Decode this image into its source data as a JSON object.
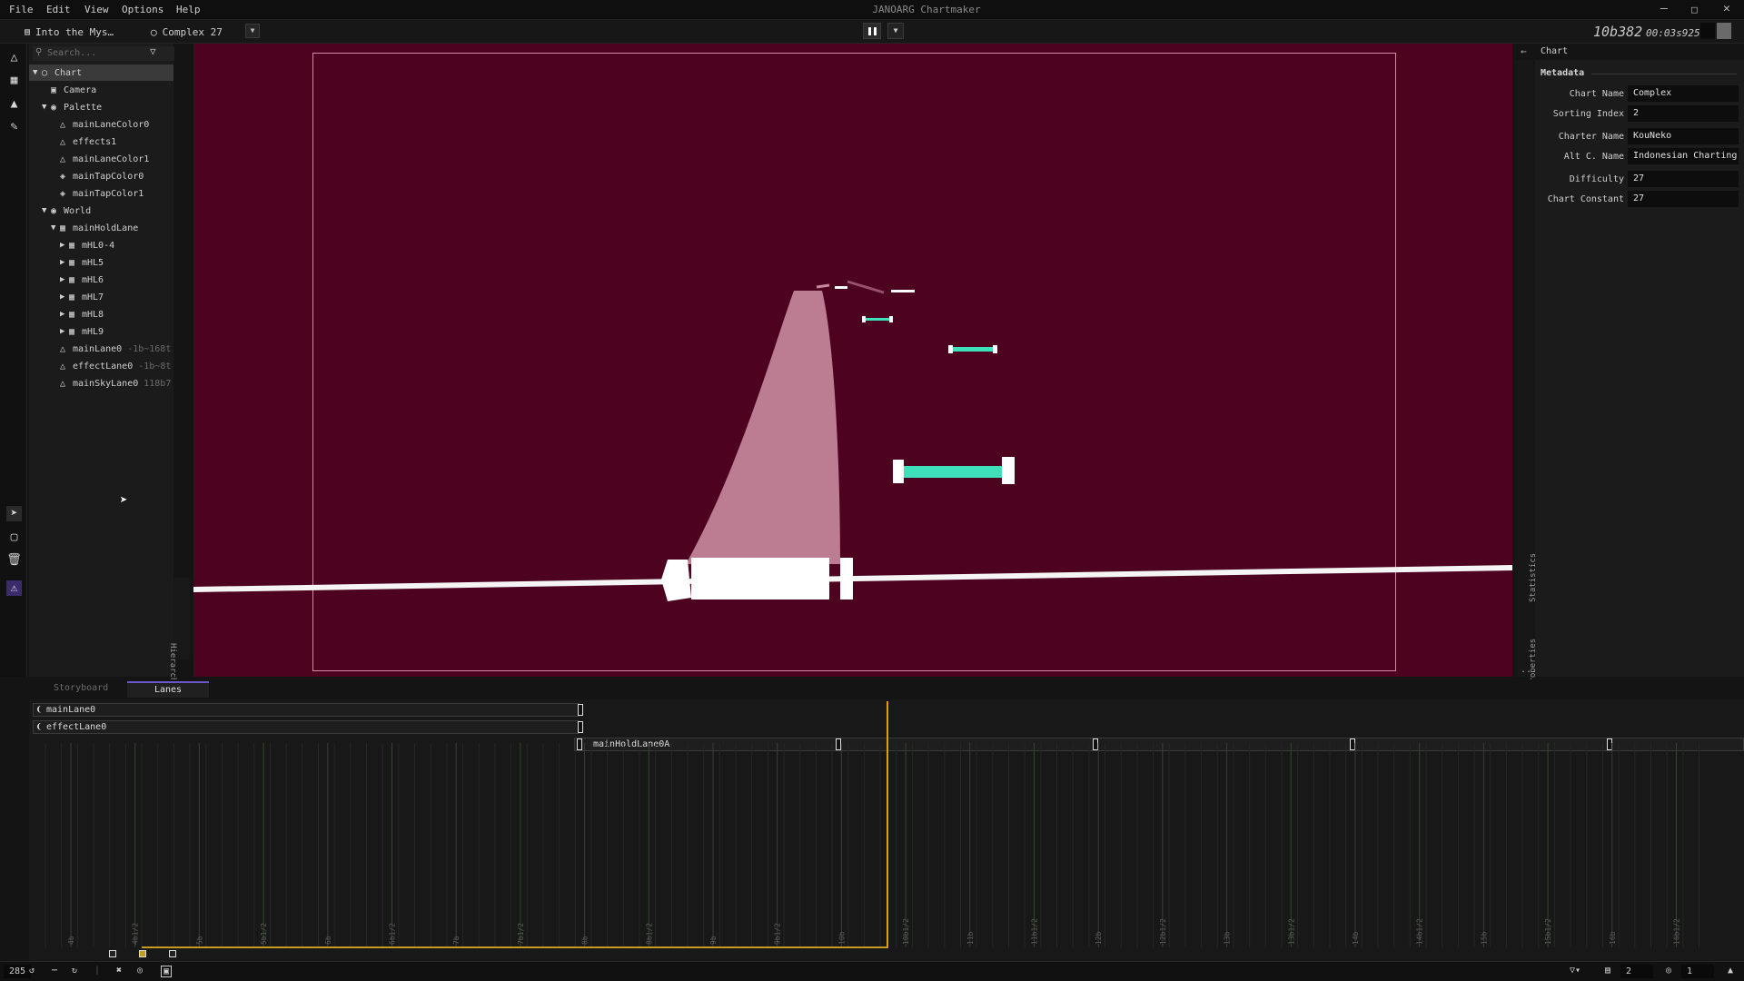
{
  "app": {
    "title": "JANOARG Chartmaker"
  },
  "menu": [
    "File",
    "Edit",
    "View",
    "Options",
    "Help"
  ],
  "toolbar": {
    "song_tab": "Into the Mys…",
    "chart_tab": "Complex 27",
    "position": "10b382",
    "time": "00:03s925"
  },
  "search": {
    "placeholder": "Search..."
  },
  "hierarchy": {
    "label": "Hierarchy",
    "items": [
      {
        "label": "Chart",
        "extra": ""
      },
      {
        "label": "Camera",
        "extra": ""
      },
      {
        "label": "Palette",
        "extra": ""
      },
      {
        "label": "mainLaneColor0",
        "extra": ""
      },
      {
        "label": "effects1",
        "extra": ""
      },
      {
        "label": "mainLaneColor1",
        "extra": ""
      },
      {
        "label": "mainTapColor0",
        "extra": ""
      },
      {
        "label": "mainTapColor1",
        "extra": ""
      },
      {
        "label": "World",
        "extra": ""
      },
      {
        "label": "mainHoldLane",
        "extra": ""
      },
      {
        "label": "mHL0-4",
        "extra": ""
      },
      {
        "label": "mHL5",
        "extra": ""
      },
      {
        "label": "mHL6",
        "extra": ""
      },
      {
        "label": "mHL7",
        "extra": ""
      },
      {
        "label": "mHL8",
        "extra": ""
      },
      {
        "label": "mHL9",
        "extra": ""
      },
      {
        "label": "mainLane0",
        "extra": "-1b~168t"
      },
      {
        "label": "effectLane0",
        "extra": "-1b~8t"
      },
      {
        "label": "mainSkyLane0",
        "extra": "118b7"
      }
    ]
  },
  "right_tabs": {
    "statistics": "Statistics",
    "properties": "Properties",
    "more": "..."
  },
  "properties": {
    "panel_title": "Chart",
    "section": "Metadata",
    "fields": [
      {
        "label": "Chart Name",
        "value": "Complex"
      },
      {
        "label": "Sorting Index",
        "value": "2"
      },
      {
        "label": "Charter Name",
        "value": "KouNeko"
      },
      {
        "label": "Alt C. Name",
        "value": "Indonesian Charting"
      },
      {
        "label": "Difficulty",
        "value": "27"
      },
      {
        "label": "Chart Constant",
        "value": "27"
      }
    ]
  },
  "timeline": {
    "tabs": [
      "Storyboard",
      "Lanes"
    ],
    "lanes": [
      "mainLane0",
      "effectLane0",
      "mainHoldLane0A"
    ],
    "ticks": [
      "4b",
      "4b1/2",
      "5b",
      "5b1/2",
      "6b",
      "6b1/2",
      "7b",
      "7b1/2",
      "8b",
      "8b1/2",
      "9b",
      "9b1/2",
      "10b",
      "10b1/2",
      "11b",
      "11b1/2",
      "12b",
      "12b1/2",
      "13b",
      "13b1/2",
      "14b",
      "14b1/2",
      "15b",
      "15b1/2",
      "16b",
      "16b1/2"
    ]
  },
  "status": {
    "bpm": "285",
    "right_val1": "2",
    "right_val2": "1"
  },
  "colors": {
    "viewport_bg": "#4d0320",
    "accent": "#6b57c7",
    "playhead": "#e0a000",
    "hold_note": "#3de0b8"
  }
}
